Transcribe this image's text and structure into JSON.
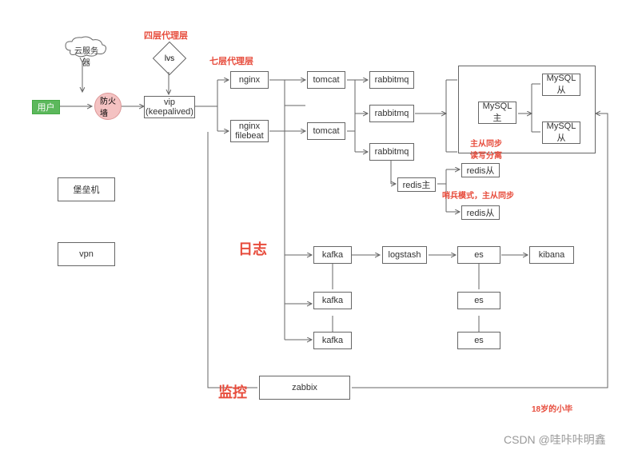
{
  "nodes": {
    "cloud": "云服务\n器",
    "user": "用户",
    "firewall": "防火\n墙",
    "lvs": "lvs",
    "vip": "vip\n(keepalived)",
    "nginx": "nginx",
    "nginx_filebeat": "nginx\nfilebeat",
    "tomcat1": "tomcat",
    "tomcat2": "tomcat",
    "rabbitmq1": "rabbitmq",
    "rabbitmq2": "rabbitmq",
    "rabbitmq3": "rabbitmq",
    "mysql_master": "MySQL\n主",
    "mysql_slave1": "MySQL\n从",
    "mysql_slave2": "MySQL\n从",
    "redis_master": "redis主",
    "redis_slave1": "redis从",
    "redis_slave2": "redis从",
    "bastion": "堡垒机",
    "vpn": "vpn",
    "kafka1": "kafka",
    "kafka2": "kafka",
    "kafka3": "kafka",
    "logstash": "logstash",
    "es1": "es",
    "es2": "es",
    "es3": "es",
    "kibana": "kibana",
    "zabbix": "zabbix"
  },
  "labels": {
    "l4_proxy": "四层代理层",
    "l7_proxy": "七层代理层",
    "mysql_sync": "主从同步\n读写分离",
    "sentinel": "哨兵模式，主从同步",
    "log": "日志",
    "monitor": "监控",
    "author": "18岁的小毕",
    "watermark": "CSDN @哇咔咔明鑫"
  }
}
